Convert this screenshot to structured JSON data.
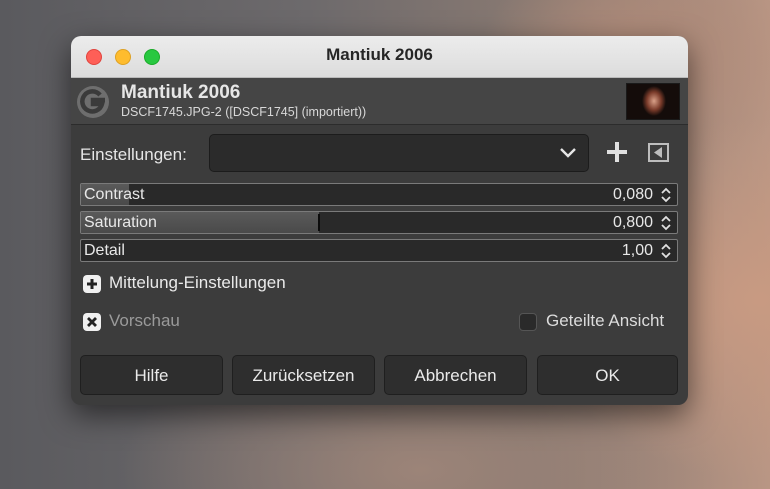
{
  "window": {
    "title": "Mantiuk 2006"
  },
  "header": {
    "plugin_name": "Mantiuk 2006",
    "image_name": "DSCF1745.JPG-2 ([DSCF1745] (importiert))"
  },
  "settings": {
    "label": "Einstellungen:",
    "value": ""
  },
  "params": [
    {
      "label": "Contrast",
      "value": "0,080",
      "fill_fraction": 0.08
    },
    {
      "label": "Saturation",
      "value": "0,800",
      "fill_fraction": 0.4
    },
    {
      "label": "Detail",
      "value": "1,00",
      "fill_fraction": 0.0
    }
  ],
  "expander": {
    "label": "Mittelung-Einstellungen"
  },
  "preview": {
    "label": "Vorschau",
    "checked": true
  },
  "split_view": {
    "label": "Geteilte Ansicht",
    "checked": false
  },
  "buttons": {
    "help": "Hilfe",
    "reset": "Zurücksetzen",
    "cancel": "Abbrechen",
    "ok": "OK"
  },
  "colors": {
    "dialog_bg": "#3c3c3c",
    "titlebar_bg": "#e4e4e4",
    "close": "#fe5f57",
    "minimize": "#febc2e",
    "maximize": "#28c840"
  }
}
